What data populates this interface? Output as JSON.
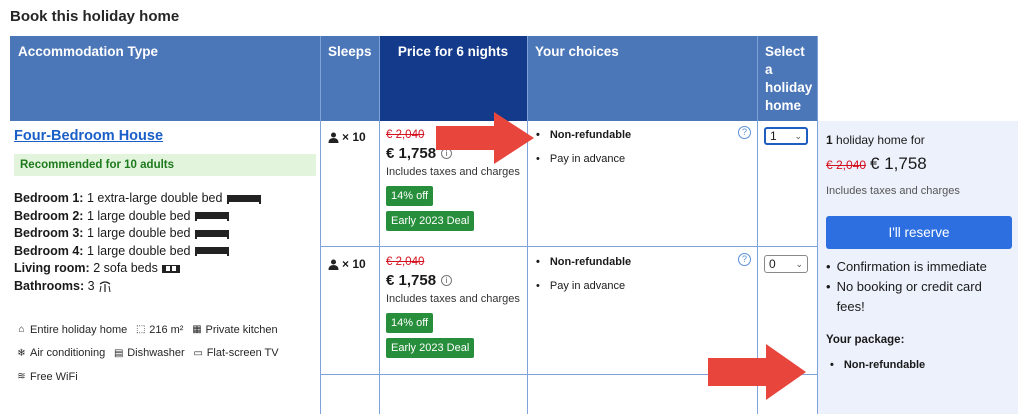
{
  "page_title": "Book this holiday home",
  "headers": {
    "accommodation": "Accommodation Type",
    "sleeps": "Sleeps",
    "price": "Price for 6 nights",
    "choices": "Your choices",
    "select": "Select a holiday home"
  },
  "accommodation": {
    "name": "Four-Bedroom House",
    "recommend": "Recommended for 10 adults",
    "beds": [
      {
        "room": "Bedroom 1:",
        "desc": "1 extra-large double bed"
      },
      {
        "room": "Bedroom 2:",
        "desc": "1 large double bed"
      },
      {
        "room": "Bedroom 3:",
        "desc": "1 large double bed"
      },
      {
        "room": "Bedroom 4:",
        "desc": "1 large double bed"
      },
      {
        "room": "Living room:",
        "desc": "2 sofa beds"
      },
      {
        "room": "Bathrooms:",
        "desc": "3"
      }
    ],
    "facilities": [
      {
        "icon": "house-icon",
        "label": "Entire holiday home"
      },
      {
        "icon": "area-icon",
        "label": "216 m²"
      },
      {
        "icon": "kitchen-icon",
        "label": "Private kitchen"
      },
      {
        "icon": "snowflake-icon",
        "label": "Air conditioning"
      },
      {
        "icon": "dishwasher-icon",
        "label": "Dishwasher"
      },
      {
        "icon": "tv-icon",
        "label": "Flat-screen TV"
      },
      {
        "icon": "wifi-icon",
        "label": "Free WiFi"
      }
    ]
  },
  "rows": [
    {
      "sleeps": "× 10",
      "old_price": "€ 2,040",
      "new_price": "€ 1,758",
      "taxes": "Includes taxes and charges",
      "discount": "14% off",
      "deal": "Early 2023 Deal",
      "choices": [
        "Non-refundable",
        "Pay in advance"
      ],
      "selected": "1"
    },
    {
      "sleeps": "× 10",
      "old_price": "€ 2,040",
      "new_price": "€ 1,758",
      "taxes": "Includes taxes and charges",
      "discount": "14% off",
      "deal": "Early 2023 Deal",
      "choices": [
        "Non-refundable",
        "Pay in advance"
      ],
      "selected": "0"
    }
  ],
  "summary": {
    "count": "1",
    "count_suffix": "holiday home for",
    "old_price": "€ 2,040",
    "new_price": "€ 1,758",
    "taxes": "Includes taxes and charges",
    "reserve_label": "I'll reserve",
    "bullets": [
      "Confirmation is immediate",
      "No booking or credit card fees!"
    ],
    "package_title": "Your package:",
    "package_items": [
      "Non-refundable"
    ]
  },
  "colors": {
    "header_blue": "#4b76b8",
    "header_dark": "#133a8b",
    "deal_green": "#278e3c",
    "strike_red": "#d4111e",
    "arrow_red": "#e8453c",
    "reserve_blue": "#2d6fe0"
  }
}
